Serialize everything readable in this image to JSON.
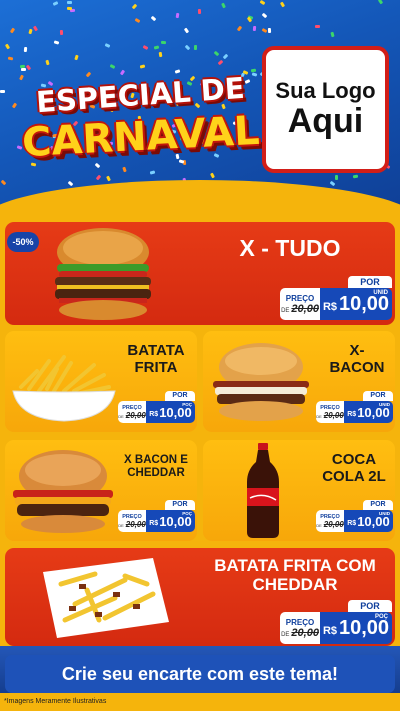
{
  "header": {
    "title_line1": "ESPECIAL DE",
    "title_line2": "CARNAVAL",
    "logo_line1": "Sua Logo",
    "logo_line2": "Aqui"
  },
  "colors": {
    "header_blue": "#1457b8",
    "card_red": "#d42a10",
    "card_yellow": "#f7a70a",
    "price_blue": "#1649b8",
    "background_yellow": "#f5b40c"
  },
  "products": [
    {
      "name": "X - TUDO",
      "badge": "-50%",
      "por": "POR",
      "preco": "PREÇO",
      "de": "DE",
      "old": "20,00",
      "rs": "R$",
      "price": "10,00",
      "unit": "UNID",
      "icon": "burger-deluxe-icon"
    },
    {
      "name_l1": "BATATA",
      "name_l2": "FRITA",
      "por": "POR",
      "preco": "PREÇO",
      "de": "DE",
      "old": "20,00",
      "rs": "R$",
      "price": "10,00",
      "unit": "POÇ",
      "icon": "fries-bowl-icon"
    },
    {
      "name_l1": "X-",
      "name_l2": "BACON",
      "por": "POR",
      "preco": "PREÇO",
      "de": "DE",
      "old": "20,00",
      "rs": "R$",
      "price": "10,00",
      "unit": "UNID",
      "icon": "bacon-burger-icon"
    },
    {
      "name_l1": "X BACON E",
      "name_l2": "CHEDDAR",
      "por": "POR",
      "preco": "PREÇO",
      "de": "DE",
      "old": "20,00",
      "rs": "R$",
      "price": "10,00",
      "unit": "POÇ",
      "icon": "cheddar-burger-icon"
    },
    {
      "name_l1": "COCA",
      "name_l2": "COLA 2L",
      "por": "POR",
      "preco": "PREÇO",
      "de": "DE",
      "old": "20,00",
      "rs": "R$",
      "price": "10,00",
      "unit": "UNID",
      "icon": "cola-bottle-icon"
    },
    {
      "name_l1": "BATATA FRITA COM",
      "name_l2": "CHEDDAR",
      "por": "POR",
      "preco": "PREÇO",
      "de": "DE",
      "old": "20,00",
      "rs": "R$",
      "price": "10,00",
      "unit": "POÇ",
      "icon": "fries-cheddar-icon"
    }
  ],
  "cta": "Crie seu encarte com este tema!",
  "footer": "*Imagens Meramente Ilustrativas"
}
